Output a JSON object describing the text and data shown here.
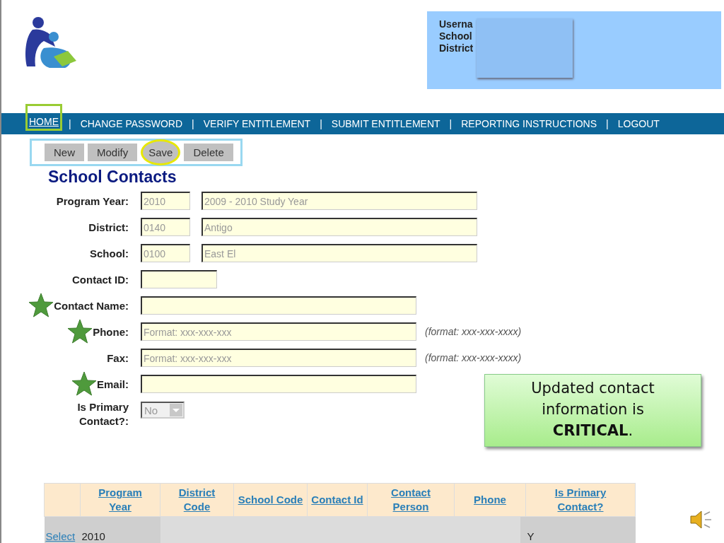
{
  "user_box": {
    "labels": [
      "Userna",
      "School",
      "District"
    ]
  },
  "nav": [
    {
      "label": "HOME",
      "highlighted": true
    },
    {
      "label": "CHANGE PASSWORD",
      "highlighted": false
    },
    {
      "label": "VERIFY ENTITLEMENT",
      "highlighted": false
    },
    {
      "label": "SUBMIT ENTITLEMENT",
      "highlighted": false
    },
    {
      "label": "REPORTING INSTRUCTIONS",
      "highlighted": false
    },
    {
      "label": "LOGOUT",
      "highlighted": false
    }
  ],
  "nav_separator": "|",
  "toolbar": [
    {
      "label": "New",
      "circled": false
    },
    {
      "label": "Modify",
      "circled": false
    },
    {
      "label": "Save",
      "circled": true
    },
    {
      "label": "Delete",
      "circled": false
    }
  ],
  "page_title": "School Contacts",
  "fields": [
    {
      "kind": "pair",
      "label": "Program Year:",
      "starred": false,
      "code": "2010",
      "name": "2009 - 2010 Study Year"
    },
    {
      "kind": "pair",
      "label": "District:",
      "starred": false,
      "code": "0140",
      "name": "Antigo"
    },
    {
      "kind": "pair",
      "label": "School:",
      "starred": false,
      "code": "0100",
      "name": "East El"
    },
    {
      "kind": "short",
      "label": "Contact ID:",
      "starred": false
    },
    {
      "kind": "long",
      "label": "Contact Name:",
      "starred": true
    },
    {
      "kind": "long",
      "label": "Phone:",
      "starred": true,
      "placeholder": "Format: xxx-xxx-xxx",
      "hint": "(format: xxx-xxx-xxxx)"
    },
    {
      "kind": "long",
      "label": "Fax:",
      "starred": false,
      "placeholder": "Format: xxx-xxx-xxx",
      "hint": "(format: xxx-xxx-xxxx)"
    },
    {
      "kind": "long",
      "label": "Email:",
      "starred": true
    },
    {
      "kind": "select",
      "label": "Is Primary Contact?:",
      "starred": false,
      "value": "No"
    }
  ],
  "callout": "Updated contact information is **CRITICAL**.",
  "table": {
    "columns": [
      "",
      "Program Year",
      "District Code",
      "School Code",
      "Contact Id",
      "Contact Person",
      "Phone",
      "Is Primary Contact?"
    ],
    "rows": [
      {
        "link": "Select",
        "program_year": "2010",
        "is_primary": "Y"
      }
    ]
  }
}
